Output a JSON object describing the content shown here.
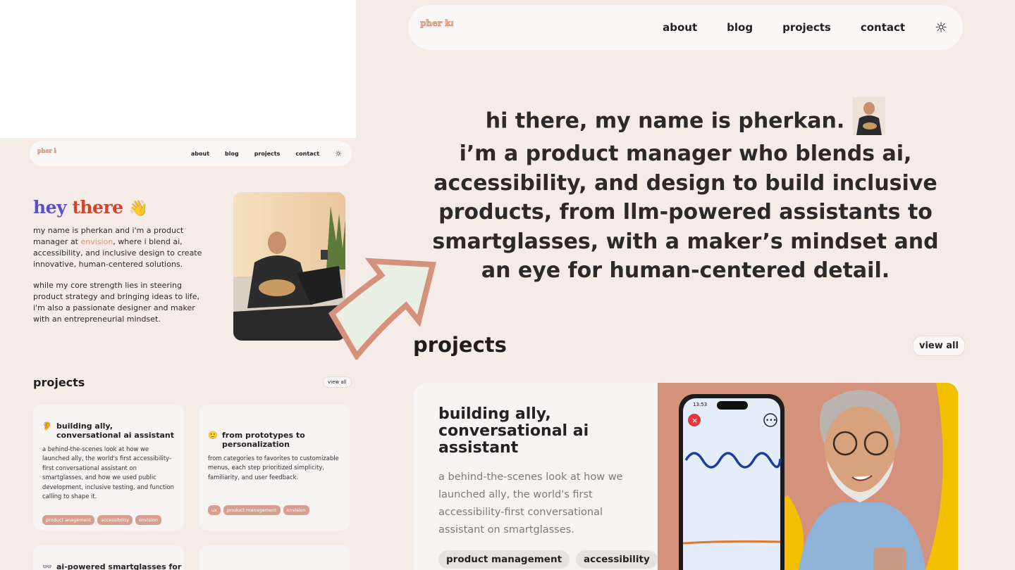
{
  "old_site": {
    "logo_text": "pher kan",
    "nav": {
      "items": [
        "about",
        "blog",
        "projects",
        "contact"
      ],
      "theme_icon": "sun-icon"
    },
    "greeting": {
      "word1": "hey",
      "word2": "there",
      "emoji": "👋"
    },
    "intro_part1": "my name is pherkan and i'm a product manager at ",
    "intro_link": "envision",
    "intro_part2": ", where i blend ai, accessibility, and inclusive design to create innovative, human-centered solutions.",
    "intro_p2": "while my core strength lies in steering product strategy and bringing ideas to life, i'm also a passionate designer and maker with an entrepreneurial mindset.",
    "projects_heading": "projects",
    "view_all": "view all",
    "cards": [
      {
        "icon": "🦻",
        "title": "building ally, conversational ai assistant",
        "description": "a behind-the-scenes look at how we launched ally, the world's first accessibility-first conversational assistant on smartglasses, and how we used public development, inclusive testing, and function calling to shape it.",
        "tags": [
          "product anagement",
          "accessibility",
          "envision"
        ]
      },
      {
        "icon": "🙂",
        "title": "from prototypes to personalization",
        "description": "from categories to favorites to customizable menus, each step prioritized simplicity, familiarity, and user feedback.",
        "tags": [
          "ux",
          "product management",
          "envision"
        ]
      },
      {
        "icon": "👓",
        "title": "ai-powered smartglasses for",
        "description": "",
        "tags": []
      }
    ]
  },
  "new_site": {
    "logo_text": "pher kan",
    "nav": {
      "items": [
        "about",
        "blog",
        "projects",
        "contact"
      ],
      "theme_icon": "sun-icon"
    },
    "hero_line1": "hi there, my name is pherkan.",
    "hero_body": "i’m a product manager who blends ai, accessibility, and design to build inclusive products, from llm-powered assistants to smartglasses, with a maker’s mindset and an eye for human-centered detail.",
    "projects_heading": "projects",
    "view_all": "view all",
    "featured": {
      "title": "building ally, conversational ai assistant",
      "description": "a behind-the-scenes look at how we launched ally, the world's first accessibility-first conversational assistant on smartglasses.",
      "tags": [
        "product management",
        "accessibility"
      ],
      "phone_time": "13:53"
    }
  },
  "colors": {
    "background": "#f5ebe7",
    "accent": "#d6907a",
    "arrow_fill": "#e9efe3",
    "arrow_stroke": "#d4917c"
  }
}
